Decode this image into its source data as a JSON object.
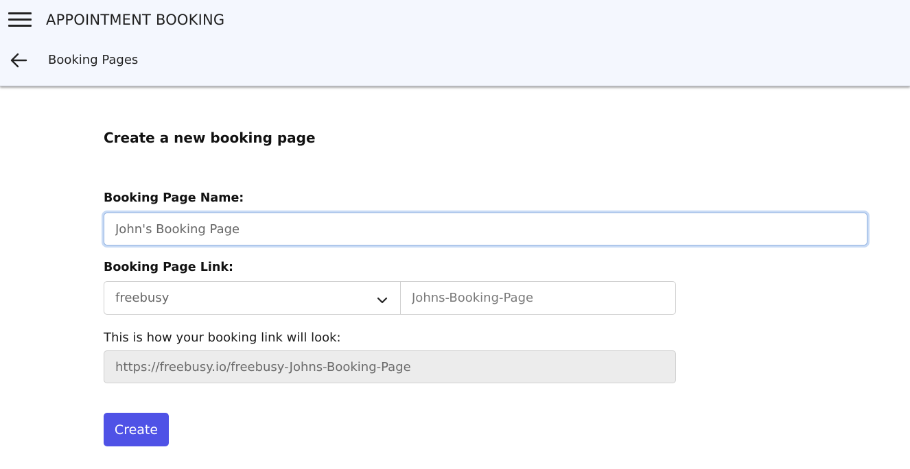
{
  "header": {
    "app_title": "APPOINTMENT BOOKING",
    "menu_icon": "hamburger-menu-icon",
    "back_icon": "arrow-left-icon",
    "breadcrumb": "Booking Pages",
    "background_color": "#f4f7fe"
  },
  "form": {
    "title": "Create a new booking page",
    "name_label": "Booking Page Name:",
    "name_value": "John's Booking Page",
    "link_label": "Booking Page Link:",
    "domain_value": "freebusy",
    "domain_icon": "chevron-down-icon",
    "slug_placeholder": "Johns-Booking-Page",
    "preview_label": "This is how your booking link will look:",
    "preview_value": "https://freebusy.io/freebusy-Johns-Booking-Page",
    "create_label": "Create",
    "accent_color": "#4f52e6"
  }
}
